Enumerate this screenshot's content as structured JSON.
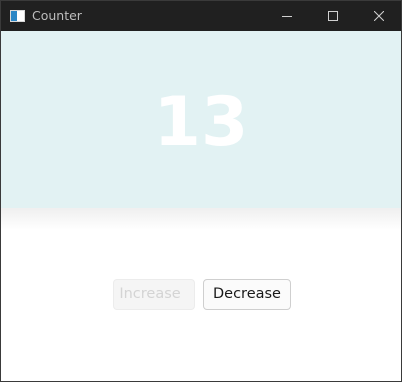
{
  "window": {
    "title": "Counter",
    "icon": "app-window-icon",
    "controls": [
      "minimize-icon",
      "maximize-icon",
      "close-icon"
    ]
  },
  "counter": {
    "value": "13"
  },
  "buttons": {
    "increase_label": "Increase",
    "increase_disabled": true,
    "decrease_label": "Decrease"
  },
  "colors": {
    "titlebar": "#202020",
    "display_background": "#e2f2f3",
    "counter_text": "#ffffff"
  }
}
